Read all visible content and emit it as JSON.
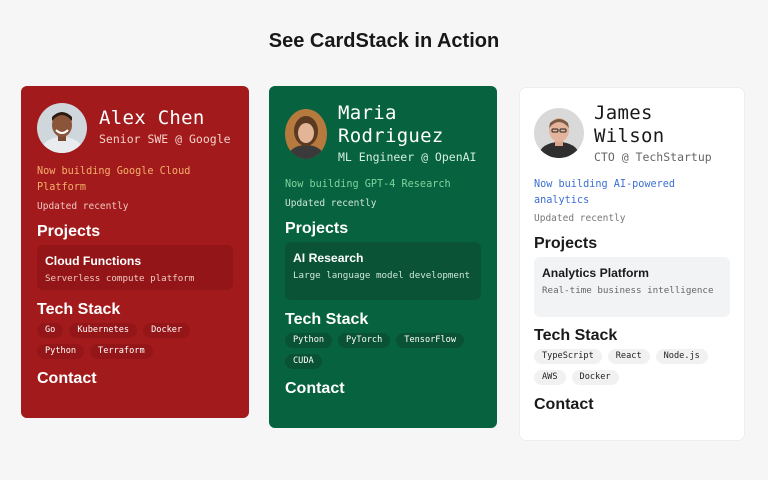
{
  "title": "See CardStack in Action",
  "cards": [
    {
      "name": "Alex Chen",
      "role": "Senior SWE @ Google",
      "building": "Now building Google Cloud Platform",
      "updated": "Updated recently",
      "projects_heading": "Projects",
      "project": {
        "title": "Cloud Functions",
        "desc": "Serverless compute platform"
      },
      "tech_heading": "Tech Stack",
      "tech": [
        "Go",
        "Kubernetes",
        "Docker",
        "Python",
        "Terraform"
      ],
      "contact_heading": "Contact",
      "colors": {
        "bg": "#a31a1c",
        "accent": "#f4b06a"
      }
    },
    {
      "name": "Maria Rodriguez",
      "role": "ML Engineer @ OpenAI",
      "building": "Now building GPT-4 Research",
      "updated": "Updated recently",
      "projects_heading": "Projects",
      "project": {
        "title": "AI Research",
        "desc": "Large language model development"
      },
      "tech_heading": "Tech Stack",
      "tech": [
        "Python",
        "PyTorch",
        "TensorFlow",
        "CUDA"
      ],
      "contact_heading": "Contact",
      "colors": {
        "bg": "#07623f",
        "accent": "#7fd49e"
      }
    },
    {
      "name": "James Wilson",
      "role": "CTO @ TechStartup",
      "building": "Now building AI-powered analytics",
      "updated": "Updated recently",
      "projects_heading": "Projects",
      "project": {
        "title": "Analytics Platform",
        "desc": "Real-time business intelligence"
      },
      "tech_heading": "Tech Stack",
      "tech": [
        "TypeScript",
        "React",
        "Node.js",
        "AWS",
        "Docker"
      ],
      "contact_heading": "Contact",
      "colors": {
        "bg": "#ffffff",
        "accent": "#3c6fd1"
      }
    }
  ]
}
